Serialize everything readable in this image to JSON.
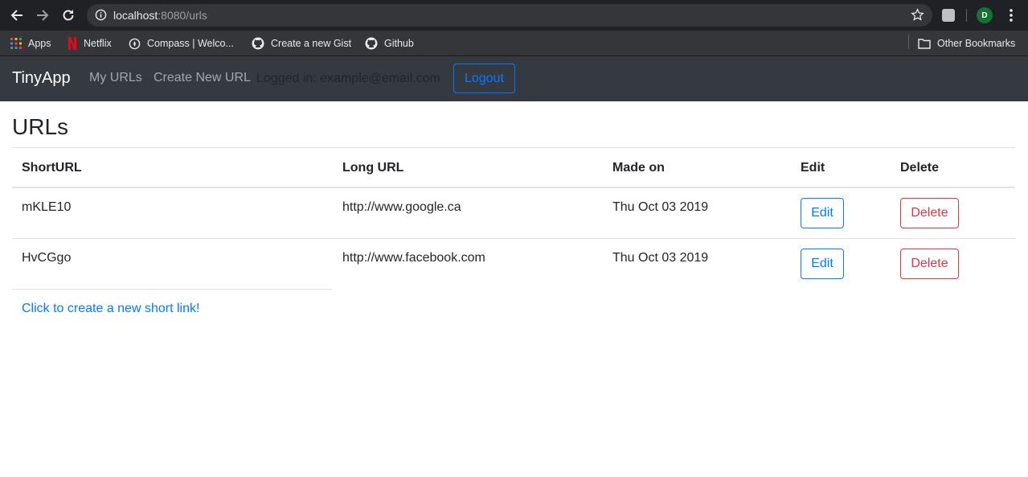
{
  "browser": {
    "url_host": "localhost",
    "url_path": ":8080/urls",
    "profile_initial": "D",
    "bookmarks": [
      {
        "label": "Apps",
        "icon": "apps-grid-icon"
      },
      {
        "label": "Netflix",
        "icon": "netflix-icon"
      },
      {
        "label": "Compass | Welco...",
        "icon": "compass-icon"
      },
      {
        "label": "Create a new Gist",
        "icon": "github-icon"
      },
      {
        "label": "Github",
        "icon": "github-icon"
      }
    ],
    "other_bookmarks": "Other Bookmarks"
  },
  "navbar": {
    "brand": "TinyApp",
    "links": [
      "My URLs",
      "Create New URL"
    ],
    "logged_in": "Logged in: example@email.com",
    "logout": "Logout"
  },
  "page": {
    "title": "URLs",
    "columns": [
      "ShortURL",
      "Long URL",
      "Made on",
      "Edit",
      "Delete"
    ],
    "rows": [
      {
        "short": "mKLE10",
        "long": "http://www.google.ca",
        "made_on": "Thu Oct 03 2019",
        "edit": "Edit",
        "delete": "Delete"
      },
      {
        "short": "HvCGgo",
        "long": "http://www.facebook.com",
        "made_on": "Thu Oct 03 2019",
        "edit": "Edit",
        "delete": "Delete"
      }
    ],
    "create_link": "Click to create a new short link!"
  },
  "colors": {
    "primary": "#007bff",
    "danger": "#dc3545",
    "navbar_bg": "#343a40",
    "chrome_bg": "#202124"
  }
}
